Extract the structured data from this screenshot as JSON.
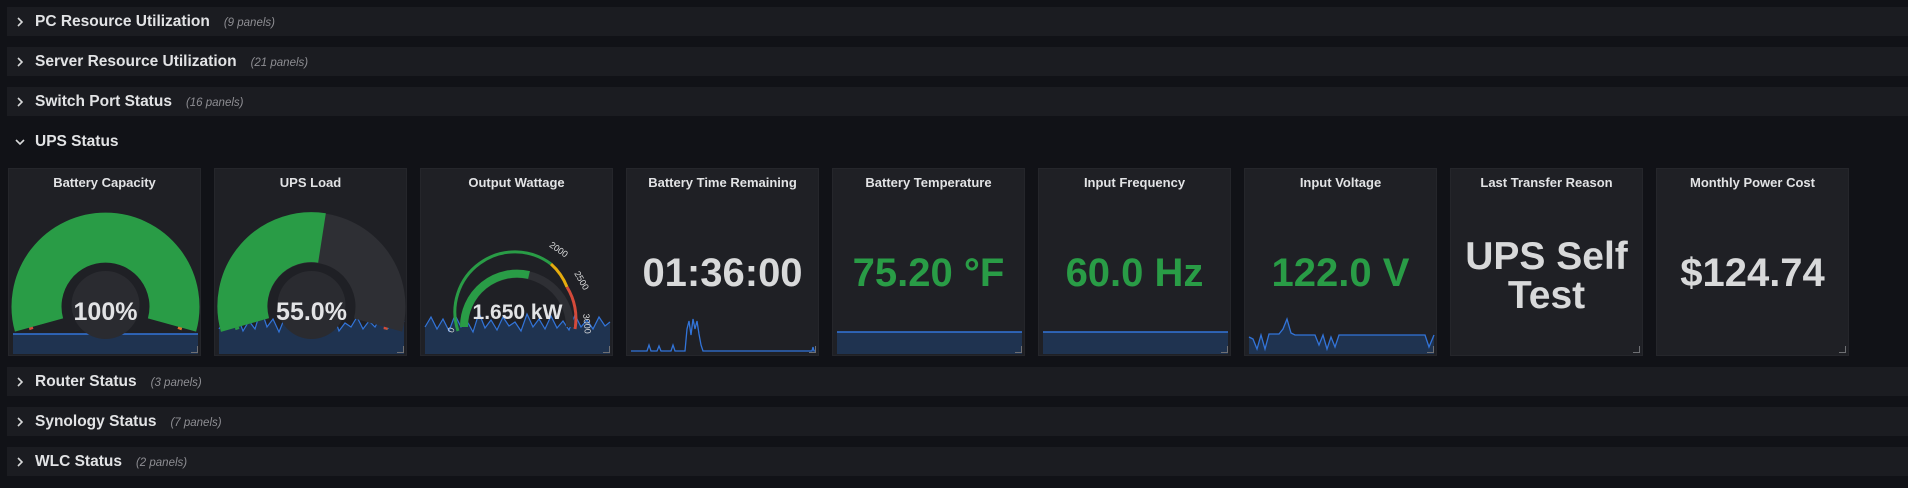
{
  "rows": [
    {
      "title": "PC Resource Utilization",
      "count": "(9 panels)",
      "collapsed": true
    },
    {
      "title": "Server Resource Utilization",
      "count": "(21 panels)",
      "collapsed": true
    },
    {
      "title": "Switch Port Status",
      "count": "(16 panels)",
      "collapsed": true
    },
    {
      "title": "UPS Status",
      "count": "",
      "collapsed": false
    },
    {
      "title": "Router Status",
      "count": "(3 panels)",
      "collapsed": true
    },
    {
      "title": "Synology Status",
      "count": "(7 panels)",
      "collapsed": true
    },
    {
      "title": "WLC Status",
      "count": "(2 panels)",
      "collapsed": true
    }
  ],
  "panels": [
    {
      "title": "Battery Capacity",
      "value": "100%",
      "type": "gauge",
      "level": 1.0,
      "color": "#299c46"
    },
    {
      "title": "UPS Load",
      "value": "55.0%",
      "type": "gauge",
      "level": 0.55,
      "color": "#299c46"
    },
    {
      "title": "Output Wattage",
      "value": "1.650 kW",
      "type": "gauge",
      "level": 0.55,
      "color": "#299c46",
      "tick_labels": [
        "0",
        "2000",
        "2500",
        "3000"
      ]
    },
    {
      "title": "Battery Time Remaining",
      "value": "01:36:00",
      "type": "stat",
      "color": "#d8d9da"
    },
    {
      "title": "Battery Temperature",
      "value": "75.20 °F",
      "type": "stat",
      "color": "#299c46"
    },
    {
      "title": "Input Frequency",
      "value": "60.0 Hz",
      "type": "stat",
      "color": "#299c46"
    },
    {
      "title": "Input Voltage",
      "value": "122.0 V",
      "type": "stat",
      "color": "#299c46"
    },
    {
      "title": "Last Transfer Reason",
      "value_lines": [
        "UPS Self",
        "Test"
      ],
      "type": "text",
      "color": "#d8d9da"
    },
    {
      "title": "Monthly Power Cost",
      "value": "$124.74",
      "type": "stat",
      "color": "#d8d9da"
    }
  ],
  "colors": {
    "green": "#299c46",
    "orange": "#e0752d",
    "red": "#d44a3a",
    "yellow": "#e5ac0e",
    "spark_line": "#3274d9",
    "spark_fill": "#1f3350"
  }
}
